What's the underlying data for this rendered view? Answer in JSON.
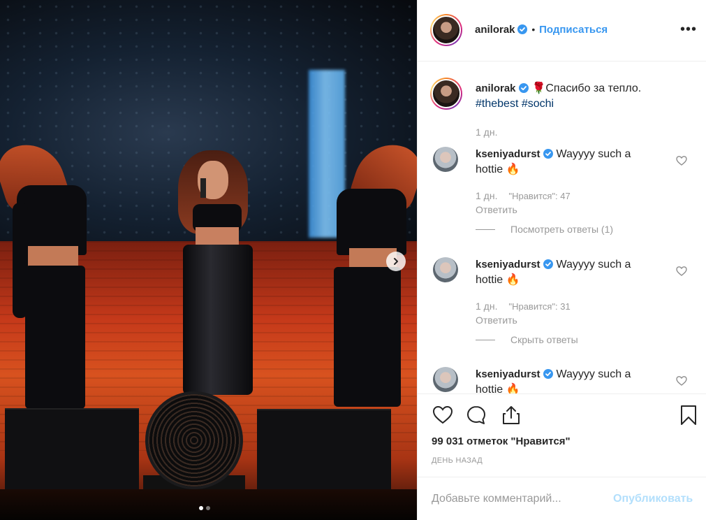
{
  "post": {
    "image_alt": "",
    "carousel": {
      "total": 2,
      "current": 1
    }
  },
  "header": {
    "username": "anilorak",
    "separator": "•",
    "follow_label": "Подписаться",
    "more_icon": "more-options-icon"
  },
  "caption": {
    "username": "anilorak",
    "text": "🌹Спасибо за тепло.",
    "hashtags": [
      "#thebest",
      "#sochi"
    ],
    "time": "1 дн."
  },
  "comments": [
    {
      "username": "kseniyadurst",
      "text": "Wayyyy such a hottie 🔥",
      "time": "1 дн.",
      "likes": "\"Нравится\": 47",
      "reply_label": "Ответить",
      "thread_label": "Посмотреть ответы (1)"
    },
    {
      "username": "kseniyadurst",
      "text": "Wayyyy such a hottie 🔥",
      "time": "1 дн.",
      "likes": "\"Нравится\": 31",
      "reply_label": "Ответить",
      "thread_label": "Скрыть ответы"
    },
    {
      "username": "kseniyadurst",
      "text": "Wayyyy such a hottie 🔥"
    }
  ],
  "stats": {
    "likes_label": "99 031 отметок \"Нравится\"",
    "date_label": "ДЕНЬ НАЗАД"
  },
  "composer": {
    "placeholder": "Добавьте комментарий...",
    "post_label": "Опубликовать"
  },
  "colors": {
    "link": "#3897f0",
    "hashtag": "#003569",
    "muted": "#999999",
    "post_disabled": "#b2dffc",
    "verified": "#3897f0"
  }
}
